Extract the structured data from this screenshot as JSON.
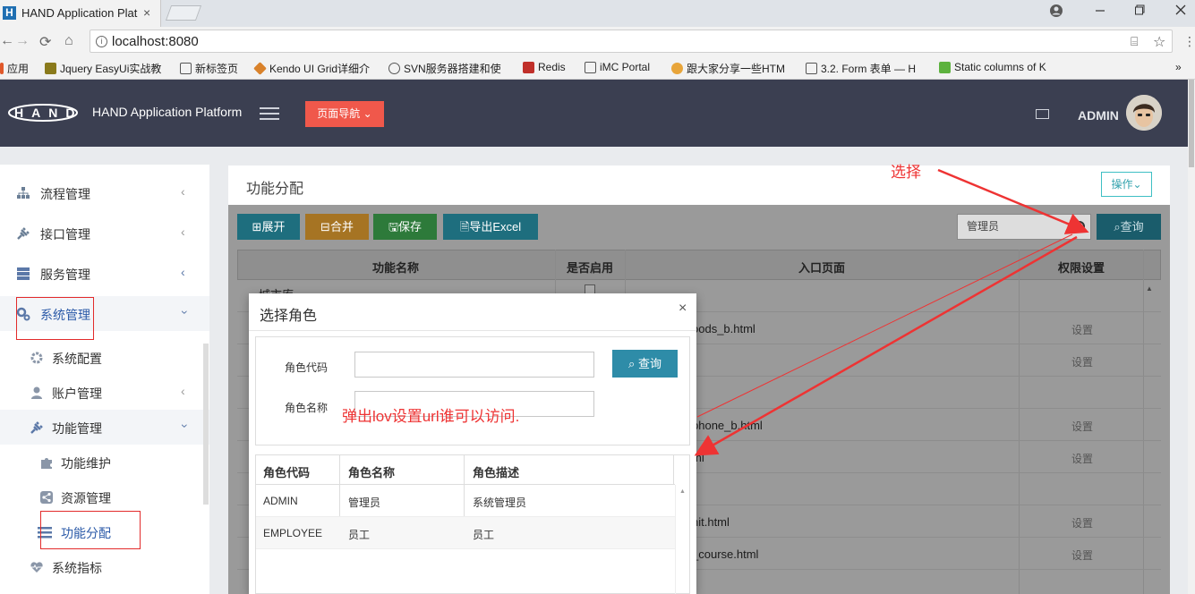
{
  "browser": {
    "tab_title": "HAND Application Plat",
    "favicon": "H",
    "tab_close": "×",
    "url": "localhost:8080",
    "bookmarks": [
      {
        "label": "应用",
        "color": "#e0592b"
      },
      {
        "label": "Jquery EasyUi实战教",
        "color": "#8a7a1c"
      },
      {
        "label": "新标签页",
        "color": "#ffffff"
      },
      {
        "label": "Kendo UI Grid详细介",
        "color": "#d9822b"
      },
      {
        "label": "SVN服务器搭建和使",
        "color": "#555555"
      },
      {
        "label": "Redis",
        "color": "#c0302a"
      },
      {
        "label": "iMC Portal",
        "color": "#ffffff"
      },
      {
        "label": "跟大家分享一些HTM",
        "color": "#e8a53a"
      },
      {
        "label": "3.2. Form 表单 — H",
        "color": "#ffffff"
      },
      {
        "label": "Static columns of K",
        "color": "#5db23e"
      }
    ],
    "more": "»"
  },
  "header": {
    "app_name": "HAND Application Platform",
    "page_nav": "页面导航 ⌄",
    "user": "ADMIN"
  },
  "sidebar": {
    "items": [
      {
        "label": "流程管理"
      },
      {
        "label": "接口管理"
      },
      {
        "label": "服务管理"
      },
      {
        "label": "系统管理"
      },
      {
        "label": "系统配置"
      },
      {
        "label": "账户管理"
      },
      {
        "label": "功能管理"
      },
      {
        "label": "功能维护"
      },
      {
        "label": "资源管理"
      },
      {
        "label": "功能分配"
      },
      {
        "label": "系统指标"
      }
    ]
  },
  "main": {
    "title": "功能分配",
    "ops": "操作⌄",
    "toolbar": {
      "expand": "⊞展开",
      "merge": "⊟合并",
      "save": "🖫保存",
      "export": "🗎导出Excel",
      "search_value": "管理员",
      "query": "查询"
    },
    "columns": [
      "功能名称",
      "是否启用",
      "入口页面",
      "权限设置"
    ],
    "first_row_partial": "城市库",
    "rows": [
      {
        "page": "",
        "setting": ""
      },
      {
        "page": "oods_b.html",
        "setting": "设置"
      },
      {
        "page": "",
        "setting": "设置"
      },
      {
        "page": "",
        "setting": ""
      },
      {
        "page": "phone_b.html",
        "setting": "设置"
      },
      {
        "page": "ml",
        "setting": "设置"
      },
      {
        "page": "",
        "setting": ""
      },
      {
        "page": "nit.html",
        "setting": "设置"
      },
      {
        "page": "_course.html",
        "setting": "设置"
      }
    ]
  },
  "modal": {
    "title": "选择角色",
    "close": "×",
    "code_label": "角色代码",
    "name_label": "角色名称",
    "query": "查询",
    "columns": [
      "角色代码",
      "角色名称",
      "角色描述"
    ],
    "rows": [
      {
        "code": "ADMIN",
        "name": "管理员",
        "desc": "系统管理员"
      },
      {
        "code": "EMPLOYEE",
        "name": "员工",
        "desc": "员工"
      }
    ]
  },
  "annotations": {
    "select": "选择",
    "popup_note": "弹出lov设置url谁可以访问."
  }
}
